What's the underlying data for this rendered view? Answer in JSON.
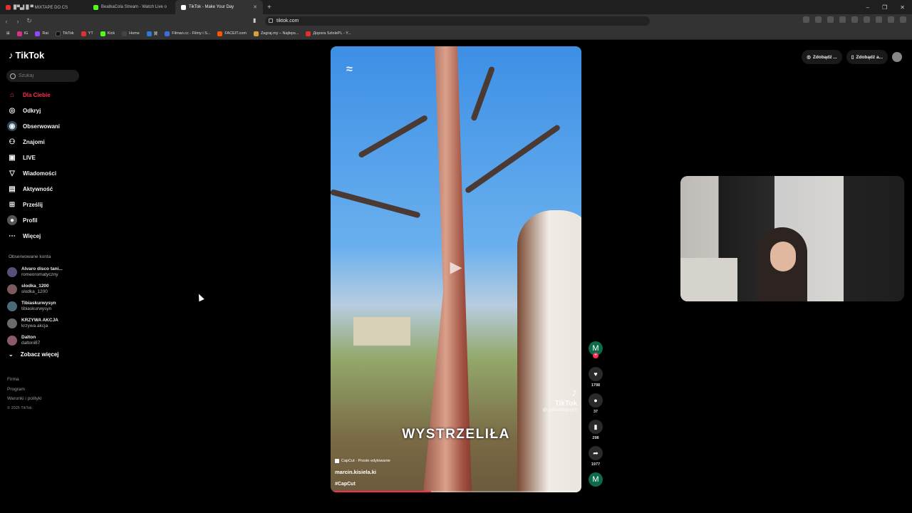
{
  "browser": {
    "tabs": [
      {
        "label": "▉▀▄▌▉ ▀ MIXTAPE DO CS",
        "color": "#e03030",
        "active": false
      },
      {
        "label": "BeatkaCola Stream - Watch Live o",
        "color": "#53fc18",
        "active": false
      },
      {
        "label": "TikTok - Make Your Day",
        "color": "#ffffff",
        "active": true
      }
    ],
    "new_tab": "+",
    "url": "tiktok.com",
    "bookmarks": [
      {
        "label": "IG",
        "color": "#d63384"
      },
      {
        "label": "Rat",
        "color": "#9146ff"
      },
      {
        "label": "TikTok",
        "color": "#111111"
      },
      {
        "label": "YT",
        "color": "#e03030"
      },
      {
        "label": "Kick",
        "color": "#53fc18"
      },
      {
        "label": "Home",
        "color": "#444444"
      },
      {
        "label": "翼",
        "color": "#2d7ad6"
      },
      {
        "label": "Filman.cc - Filmy i S...",
        "color": "#3a6ee0"
      },
      {
        "label": "FACEIT.com",
        "color": "#ff5500"
      },
      {
        "label": "Zagraj.my – Najleps...",
        "color": "#d6a23a"
      },
      {
        "label": "Дорога SzlolePL - Y...",
        "color": "#e03030"
      }
    ]
  },
  "sidebar": {
    "logo": "TikTok",
    "search_placeholder": "Szukaj",
    "nav": [
      {
        "label": "Dla Ciebie",
        "icon": "home-icon",
        "active": true
      },
      {
        "label": "Odkryj",
        "icon": "compass-icon",
        "active": false
      },
      {
        "label": "Obserwowani",
        "icon": "following-icon",
        "active": false
      },
      {
        "label": "Znajomi",
        "icon": "friends-icon",
        "active": false
      },
      {
        "label": "LIVE",
        "icon": "live-icon",
        "active": false
      },
      {
        "label": "Wiadomości",
        "icon": "messages-icon",
        "active": false
      },
      {
        "label": "Aktywność",
        "icon": "activity-icon",
        "active": false
      },
      {
        "label": "Prześlij",
        "icon": "upload-icon",
        "active": false
      },
      {
        "label": "Profil",
        "icon": "profile-icon",
        "active": false
      },
      {
        "label": "Więcej",
        "icon": "more-icon",
        "active": false
      }
    ],
    "following_title": "Obserwowane konta",
    "following": [
      {
        "name": "Alvaro disco tani...",
        "user": "romeoromatyczny",
        "color": "#5a4f7a"
      },
      {
        "name": "slodka_1200",
        "user": "slodka_1200",
        "color": "#7a5a5a"
      },
      {
        "name": "Tibiaskurwysyn",
        "user": "tibiaskurwysyn",
        "color": "#4a6a7a"
      },
      {
        "name": "KRZYWA AKCJA",
        "user": "krzywa.akcja",
        "color": "#6a6a6a"
      },
      {
        "name": "Dalton",
        "user": "daltoni87",
        "color": "#8a5a6a"
      }
    ],
    "see_more": "Zobacz więcej",
    "footer": [
      "Firma",
      "Program",
      "Warunki i polityki"
    ],
    "copyright": "© 2025 TikTok"
  },
  "video": {
    "caption": "WYSTRZELIŁA",
    "watermark_brand": "TikTok",
    "watermark_handle": "@ jestemfajny85",
    "capcut_tag": "CapCut · Proste edytowanie",
    "author": "marcin.kisiela.ki",
    "hashtag": "#CapCut",
    "progress": 0.4
  },
  "actions": {
    "author_initial": "M",
    "likes": "1798",
    "comments": "37",
    "saves": "298",
    "shares": "1977",
    "sound_initial": "M"
  },
  "topright": {
    "coins": "Zdobądź ...",
    "app": "Zdobądź a..."
  }
}
